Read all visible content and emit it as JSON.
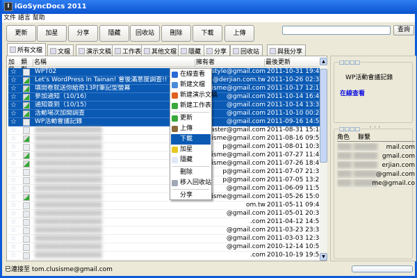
{
  "window": {
    "title": "iGoSyncDocs 2011",
    "icon": "app-icon"
  },
  "menu": "文件 語言 幫助",
  "toolbar": [
    "更新",
    "加星",
    "分享",
    "隱藏",
    "回收站",
    "刪除",
    "下載",
    "上傳"
  ],
  "search": {
    "value": "",
    "button": "查詢"
  },
  "tabs": [
    "所有文檔",
    "文檔",
    "演示文稿",
    "工作表",
    "其他文檔",
    "隱藏",
    "分享",
    "回收站",
    "與我分享"
  ],
  "columns": [
    "加星",
    "類型",
    "名稱",
    "擁有者",
    "最後更新"
  ],
  "rows": [
    {
      "type": "doc",
      "name": "WPT02",
      "owner": "style@gmail.com",
      "date": "2011-10-31 19:42:07",
      "selected": true
    },
    {
      "type": "sheet",
      "name": "Let's WordPress In Tainan! 會後滿意度調查!!",
      "owner": "@derjian.com.tw",
      "date": "2011-10-26 02:39:10",
      "selected": true
    },
    {
      "type": "sheet",
      "name": "填問卷就送你給奇13吋筆記型螢幕",
      "owner": "isisme@gmail.com",
      "date": "2011-10-17 12:18:44",
      "selected": true
    },
    {
      "type": "sheet",
      "name": "參加通知（10/16）",
      "owner": "@gmail.com",
      "date": "2011-10-14 16:48:36",
      "selected": true
    },
    {
      "type": "sheet",
      "name": "通知簽到（10/15）",
      "owner": "@gmail.com",
      "date": "2011-10-14 13:32:36",
      "selected": true
    },
    {
      "type": "sheet",
      "name": "活動場次加開調查",
      "owner": "@gmail.com",
      "date": "2011-10-10 00:24:32",
      "selected": true
    },
    {
      "type": "doc",
      "name": "WP活動會議記錄",
      "owner": "@gmail.com",
      "date": "2011-09-16 14:54:30",
      "selected": true
    },
    {
      "type": "doc",
      "name": "",
      "owner": "hmaster@gmail.com",
      "date": "2011-08-31 15:14:09"
    },
    {
      "type": "sheet",
      "name": "",
      "owner": "isisme@gmail.com",
      "date": "2011-08-16 09:51:55"
    },
    {
      "type": "doc",
      "name": "",
      "owner": "p@gmail.com",
      "date": "2011-08-01 10:31:44"
    },
    {
      "type": "sheet",
      "name": "",
      "owner": "isisme@gmail.com",
      "date": "2011-07-27 11:42:54"
    },
    {
      "type": "sheet",
      "name": "",
      "owner": "isisme@gmail.com",
      "date": "2011-07-26 18:43:44"
    },
    {
      "type": "doc",
      "name": "",
      "owner": "p@gmail.com",
      "date": "2011-07-07 21:35:19"
    },
    {
      "type": "doc",
      "name": "",
      "owner": "p@gmail.com",
      "date": "2011-07-05 13:27:12"
    },
    {
      "type": "doc",
      "name": "",
      "owner": "@gmail.com",
      "date": "2011-06-09 11:58:39"
    },
    {
      "type": "sheet",
      "name": "",
      "owner": "isisme@gmail.com",
      "date": "2011-05-26 15:07:09"
    },
    {
      "type": "doc",
      "name": "",
      "owner": "om.tw",
      "date": "2011-05-11 09:44:56"
    },
    {
      "type": "doc",
      "name": "",
      "owner": "@gmail.com",
      "date": "2011-05-01 20:32:29"
    },
    {
      "type": "doc",
      "name": "",
      "owner": ".com",
      "date": "2011-04-12 14:56:42"
    },
    {
      "type": "doc",
      "name": "",
      "owner": "@gmail.com",
      "date": "2011-03-23 23:35:32"
    },
    {
      "type": "doc",
      "name": "",
      "owner": "@gmail.com",
      "date": "2011-03-03 12:34:10"
    },
    {
      "type": "doc",
      "name": "",
      "owner": "@gmail.com",
      "date": "2010-12-14 10:50:50"
    },
    {
      "type": "doc",
      "name": "",
      "owner": ".com",
      "date": "2010-10-19 19:50:43"
    }
  ],
  "context_menu": [
    {
      "label": "在線查看",
      "icon": "view-online-icon",
      "color": "#2a6ad8"
    },
    {
      "label": "新建文檔",
      "icon": "new-doc-icon",
      "color": "#4a8ad8"
    },
    {
      "label": "新建演示文稿",
      "icon": "new-presentation-icon",
      "color": "#e06020"
    },
    {
      "label": "新建工作表",
      "icon": "new-sheet-icon",
      "color": "#3aa83a"
    },
    {
      "sep": true
    },
    {
      "label": "更新",
      "icon": "refresh-icon",
      "color": "#3aa83a"
    },
    {
      "label": "上傳",
      "icon": "upload-icon",
      "color": "#8a6a3a"
    },
    {
      "label": "下載",
      "icon": "",
      "highlighted": true
    },
    {
      "label": "加星",
      "icon": "star-icon",
      "color": "#e8c820"
    },
    {
      "label": "隱藏",
      "icon": "hide-icon",
      "color": "#e0e8f8"
    },
    {
      "sep": true
    },
    {
      "label": "刪除",
      "icon": ""
    },
    {
      "label": "移入回收站",
      "icon": "trash-icon",
      "color": "#a0a8b8"
    },
    {
      "sep": true
    },
    {
      "label": "分享",
      "icon": ""
    }
  ],
  "detail": {
    "group_title": "□□□□",
    "doc_name": "WP活動會議記錄",
    "view_link": "在線查看"
  },
  "members": {
    "group_title": "□□□□",
    "columns": [
      "角色",
      "聯繫"
    ],
    "rows": [
      {
        "role": "",
        "contact": "mail.com"
      },
      {
        "role": "",
        "contact": "gmail.com"
      },
      {
        "role": "",
        "contact": "erjian.com"
      },
      {
        "role": "",
        "contact": "@gmail.com"
      },
      {
        "role": "",
        "contact": "me@gmail.co"
      }
    ]
  },
  "status": "已連接至 tom.clusisme@gmail.com",
  "colors": {
    "selection": "#0a5ab4",
    "titlebar": "#0a52d0",
    "link": "#1010e0"
  }
}
